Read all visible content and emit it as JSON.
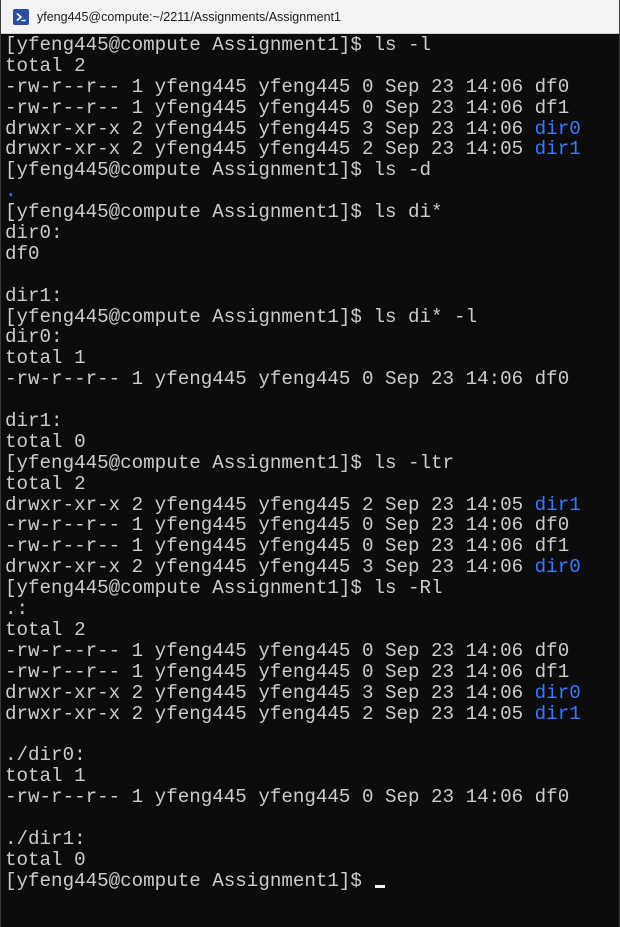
{
  "window": {
    "title": "yfeng445@compute:~/2211/Assignments/Assignment1",
    "icon": "terminal-icon",
    "accent_color": "#2b4f9e"
  },
  "colors": {
    "background": "#0c0c0c",
    "text": "#cccccc",
    "directory": "#3b78ff"
  },
  "lines": [
    {
      "text": "[yfeng445@compute Assignment1]$ ls -l"
    },
    {
      "text": "total 2"
    },
    {
      "text": "-rw-r--r-- 1 yfeng445 yfeng445 0 Sep 23 14:06 ",
      "dir": "df0",
      "dirstyle": false
    },
    {
      "text": "-rw-r--r-- 1 yfeng445 yfeng445 0 Sep 23 14:06 df1"
    },
    {
      "text": "drwxr-xr-x 2 yfeng445 yfeng445 3 Sep 23 14:06 ",
      "dir": "dir0"
    },
    {
      "text": "drwxr-xr-x 2 yfeng445 yfeng445 2 Sep 23 14:05 ",
      "dir": "dir1"
    },
    {
      "text": "[yfeng445@compute Assignment1]$ ls -d"
    },
    {
      "text": "",
      "dir": "."
    },
    {
      "text": "[yfeng445@compute Assignment1]$ ls di*"
    },
    {
      "text": "dir0:"
    },
    {
      "text": "df0"
    },
    {
      "text": ""
    },
    {
      "text": "dir1:"
    },
    {
      "text": "[yfeng445@compute Assignment1]$ ls di* -l"
    },
    {
      "text": "dir0:"
    },
    {
      "text": "total 1"
    },
    {
      "text": "-rw-r--r-- 1 yfeng445 yfeng445 0 Sep 23 14:06 df0"
    },
    {
      "text": ""
    },
    {
      "text": "dir1:"
    },
    {
      "text": "total 0"
    },
    {
      "text": "[yfeng445@compute Assignment1]$ ls -ltr"
    },
    {
      "text": "total 2"
    },
    {
      "text": "drwxr-xr-x 2 yfeng445 yfeng445 2 Sep 23 14:05 ",
      "dir": "dir1"
    },
    {
      "text": "-rw-r--r-- 1 yfeng445 yfeng445 0 Sep 23 14:06 df0"
    },
    {
      "text": "-rw-r--r-- 1 yfeng445 yfeng445 0 Sep 23 14:06 df1"
    },
    {
      "text": "drwxr-xr-x 2 yfeng445 yfeng445 3 Sep 23 14:06 ",
      "dir": "dir0"
    },
    {
      "text": "[yfeng445@compute Assignment1]$ ls -Rl"
    },
    {
      "text": ".:"
    },
    {
      "text": "total 2"
    },
    {
      "text": "-rw-r--r-- 1 yfeng445 yfeng445 0 Sep 23 14:06 df0"
    },
    {
      "text": "-rw-r--r-- 1 yfeng445 yfeng445 0 Sep 23 14:06 df1"
    },
    {
      "text": "drwxr-xr-x 2 yfeng445 yfeng445 3 Sep 23 14:06 ",
      "dir": "dir0"
    },
    {
      "text": "drwxr-xr-x 2 yfeng445 yfeng445 2 Sep 23 14:05 ",
      "dir": "dir1"
    },
    {
      "text": ""
    },
    {
      "text": "./dir0:"
    },
    {
      "text": "total 1"
    },
    {
      "text": "-rw-r--r-- 1 yfeng445 yfeng445 0 Sep 23 14:06 df0"
    },
    {
      "text": ""
    },
    {
      "text": "./dir1:"
    },
    {
      "text": "total 0"
    },
    {
      "text": "[yfeng445@compute Assignment1]$ ",
      "cursor": true
    }
  ]
}
